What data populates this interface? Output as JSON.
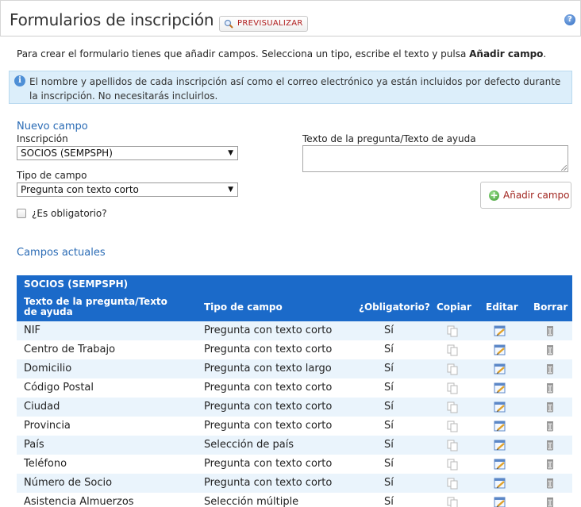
{
  "header": {
    "title": "Formularios de inscripción",
    "preview_label": "PREVISUALIZAR"
  },
  "intro": {
    "text": "Para crear el formulario tienes que añadir campos. Selecciona un tipo, escribe el texto y pulsa ",
    "bold": "Añadir campo",
    "end": "."
  },
  "info": {
    "text": "El nombre y apellidos de cada inscripción así como el correo electrónico ya están incluidos por defecto durante la inscripción. No necesitarás incluirlos."
  },
  "new_field": {
    "title": "Nuevo campo",
    "inscription_label": "Inscripción",
    "inscription_value": "SOCIOS (SEMPSPH)",
    "type_label": "Tipo de campo",
    "type_value": "Pregunta con texto corto",
    "required_label": "¿Es obligatorio?",
    "question_label": "Texto de la pregunta/Texto de ayuda",
    "add_button": "Añadir campo"
  },
  "current": {
    "title": "Campos actuales",
    "group": "SOCIOS (SEMPSPH)",
    "columns": {
      "question": "Texto de la pregunta/Texto de ayuda",
      "type": "Tipo de campo",
      "required": "¿Obligatorio?",
      "copy": "Copiar",
      "edit": "Editar",
      "delete": "Borrar"
    },
    "rows": [
      {
        "question": "NIF",
        "type": "Pregunta con texto corto",
        "required": "Sí"
      },
      {
        "question": "Centro de Trabajo",
        "type": "Pregunta con texto corto",
        "required": "Sí"
      },
      {
        "question": "Domicilio",
        "type": "Pregunta con texto largo",
        "required": "Sí"
      },
      {
        "question": "Código Postal",
        "type": "Pregunta con texto corto",
        "required": "Sí"
      },
      {
        "question": "Ciudad",
        "type": "Pregunta con texto corto",
        "required": "Sí"
      },
      {
        "question": "Provincia",
        "type": "Pregunta con texto corto",
        "required": "Sí"
      },
      {
        "question": "País",
        "type": "Selección de país",
        "required": "Sí"
      },
      {
        "question": "Teléfono",
        "type": "Pregunta con texto corto",
        "required": "Sí"
      },
      {
        "question": "Número de Socio",
        "type": "Pregunta con texto corto",
        "required": "Sí"
      },
      {
        "question": "Asistencia Almuerzos",
        "type": "Selección múltiple",
        "required": "Sí"
      }
    ]
  }
}
